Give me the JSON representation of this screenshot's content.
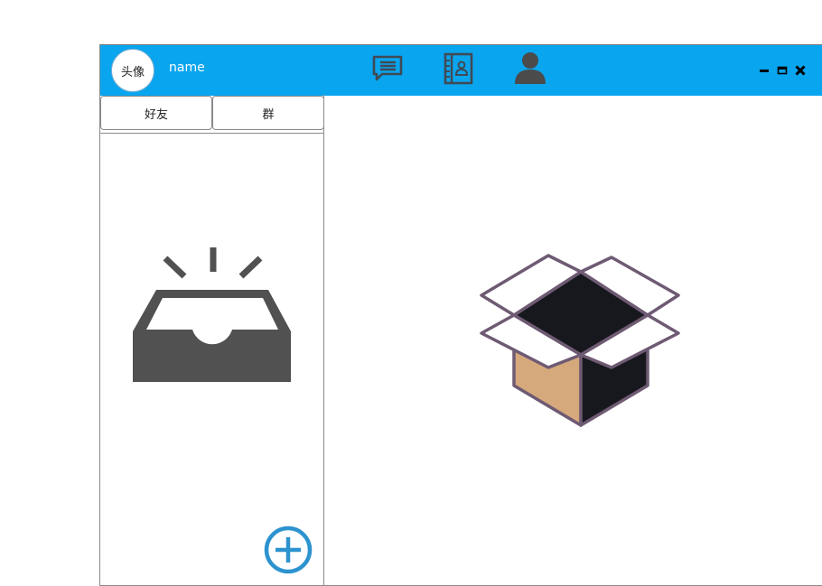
{
  "header": {
    "avatar_label": "头像",
    "username": "name",
    "nav": [
      {
        "icon": "chat-icon"
      },
      {
        "icon": "contacts-book-icon"
      },
      {
        "icon": "user-profile-icon"
      }
    ],
    "window_controls": [
      "minimize-icon",
      "maximize-icon",
      "close-icon"
    ]
  },
  "sidebar": {
    "tabs": [
      {
        "label": "好友"
      },
      {
        "label": "群"
      }
    ],
    "empty_icon": "empty-inbox-icon",
    "add_icon": "add-circle-icon"
  },
  "main": {
    "empty_icon": "empty-box-icon"
  },
  "colors": {
    "accent": "#0aa5ef",
    "icon_dark": "#4d4d4d",
    "add_button": "#2d93cf",
    "box_outline": "#6e5a73",
    "box_inside": "#16181d",
    "box_side": "#d6a97c"
  }
}
